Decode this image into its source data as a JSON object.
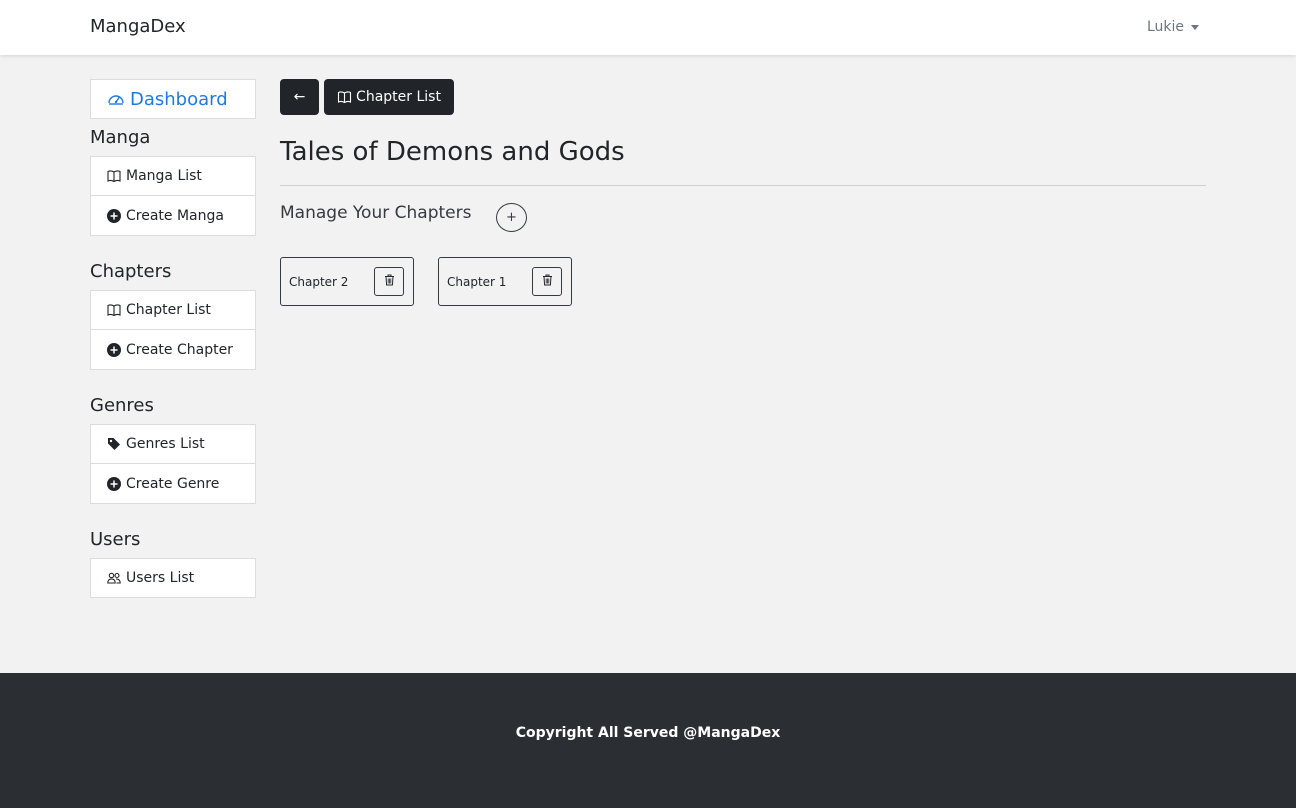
{
  "navbar": {
    "brand": "MangaDex",
    "user": "Lukie"
  },
  "sidebar": {
    "dashboard": "Dashboard",
    "sections": [
      {
        "heading": "Manga",
        "items": [
          {
            "label": "Manga List",
            "icon": "book-icon"
          },
          {
            "label": "Create Manga",
            "icon": "plus-circle-icon"
          }
        ]
      },
      {
        "heading": "Chapters",
        "items": [
          {
            "label": "Chapter List",
            "icon": "book-icon"
          },
          {
            "label": "Create Chapter",
            "icon": "plus-circle-icon"
          }
        ]
      },
      {
        "heading": "Genres",
        "items": [
          {
            "label": "Genres List",
            "icon": "tag-icon"
          },
          {
            "label": "Create Genre",
            "icon": "plus-circle-icon"
          }
        ]
      },
      {
        "heading": "Users",
        "items": [
          {
            "label": "Users List",
            "icon": "people-icon"
          }
        ]
      }
    ]
  },
  "main": {
    "back_label": "←",
    "chapter_list_label": "Chapter List",
    "title": "Tales of Demons and Gods",
    "subtitle": "Manage Your Chapters",
    "add_label": "+",
    "chapters": [
      {
        "label": "Chapter 2"
      },
      {
        "label": "Chapter 1"
      }
    ]
  },
  "footer": {
    "text": "Copyright All Served @MangaDex"
  },
  "colors": {
    "accent": "#1f7ae0",
    "dark": "#212529",
    "footer_bg": "#2b2f33"
  }
}
